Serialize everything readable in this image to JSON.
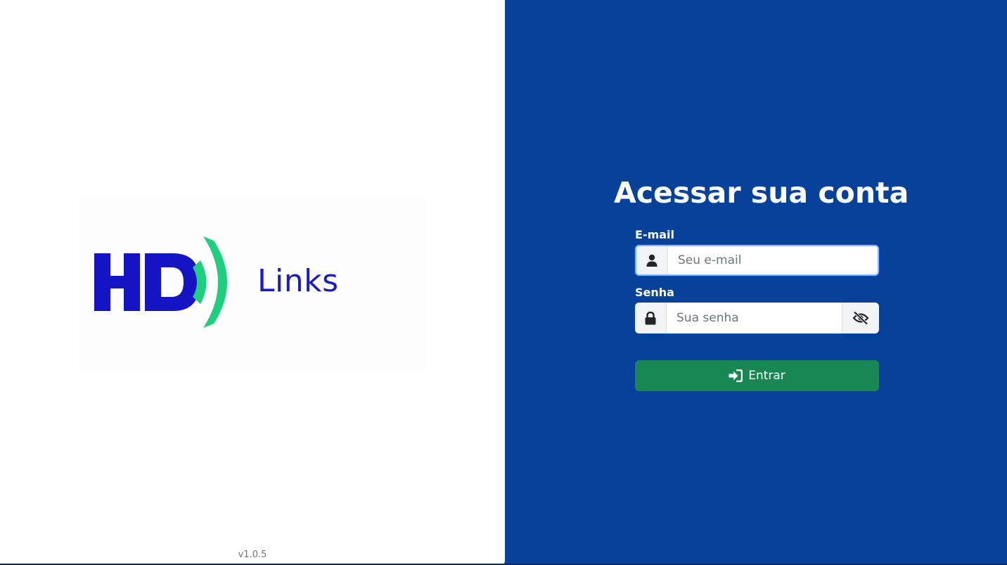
{
  "brand": {
    "logo_text": "Links",
    "logo_icon": "hd-signal-logo",
    "colors": {
      "logo_blue": "#1a1bc2",
      "logo_green": "#1fcf7e"
    }
  },
  "footer": {
    "version": "v1.0.5"
  },
  "login_form": {
    "title": "Acessar sua conta",
    "email": {
      "label": "E-mail",
      "placeholder": "Seu e-mail",
      "value": "",
      "icon": "user-icon"
    },
    "password": {
      "label": "Senha",
      "placeholder": "Sua senha",
      "value": "",
      "icon": "lock-icon",
      "toggle_icon": "eye-slash-icon"
    },
    "submit": {
      "label": "Entrar",
      "icon": "sign-in-icon"
    }
  },
  "theme": {
    "panel_blue": "#07419a",
    "button_green": "#198754"
  }
}
